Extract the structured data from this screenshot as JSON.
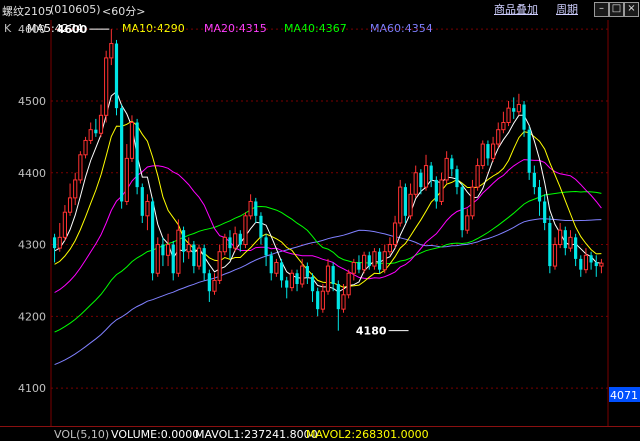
{
  "header": {
    "symbol": "螺纹2105",
    "code": "(010605)",
    "period": "<60分>",
    "k_label": "K",
    "ma5": "MA5:4274",
    "ma10": "MA10:4290",
    "ma20": "MA20:4315",
    "ma40": "MA40:4367",
    "ma60": "MA60:4354",
    "btn_overlay": "商品叠加",
    "btn_cycle": "周期"
  },
  "footer": {
    "vol": "VOL(5,10)",
    "volume": "VOLUME:0.0000",
    "mavol1": "MAVOL1:237241.8000",
    "mavol2": "MAVOL2:268301.0000"
  },
  "colors": {
    "up": "#ff3232",
    "down": "#00e6e6",
    "ma5": "#ffffff",
    "ma10": "#ffff00",
    "ma20": "#ff00ff",
    "ma40": "#00ff00",
    "ma60": "#8080ff",
    "grid": "#7a0000",
    "axis_text": "#c0c0c0",
    "price_box": "#0050ff"
  },
  "chart_data": {
    "type": "candlestick",
    "ylim": [
      4050,
      4610
    ],
    "y_ticks": [
      4600,
      4500,
      4400,
      4300,
      4200,
      4100
    ],
    "current_price": "4071",
    "annotations": [
      {
        "label": "4600",
        "index": 11,
        "value": 4600
      },
      {
        "label": "4180",
        "index": 69,
        "value": 4180
      }
    ],
    "candles": [
      [
        4310,
        4295,
        4315,
        4275
      ],
      [
        4295,
        4310,
        4330,
        4290
      ],
      [
        4310,
        4345,
        4355,
        4305
      ],
      [
        4345,
        4365,
        4385,
        4340
      ],
      [
        4365,
        4390,
        4400,
        4355
      ],
      [
        4390,
        4425,
        4430,
        4385
      ],
      [
        4425,
        4445,
        4450,
        4420
      ],
      [
        4445,
        4460,
        4470,
        4440
      ],
      [
        4460,
        4455,
        4475,
        4450
      ],
      [
        4455,
        4480,
        4495,
        4450
      ],
      [
        4480,
        4560,
        4570,
        4470
      ],
      [
        4560,
        4580,
        4600,
        4550
      ],
      [
        4580,
        4490,
        4585,
        4480
      ],
      [
        4490,
        4360,
        4495,
        4350
      ],
      [
        4360,
        4420,
        4440,
        4355
      ],
      [
        4420,
        4470,
        4480,
        4415
      ],
      [
        4470,
        4380,
        4475,
        4370
      ],
      [
        4380,
        4340,
        4385,
        4330
      ],
      [
        4340,
        4360,
        4370,
        4320
      ],
      [
        4360,
        4260,
        4365,
        4250
      ],
      [
        4260,
        4300,
        4310,
        4255
      ],
      [
        4300,
        4285,
        4310,
        4270
      ],
      [
        4285,
        4300,
        4315,
        4270
      ],
      [
        4300,
        4260,
        4305,
        4250
      ],
      [
        4260,
        4320,
        4335,
        4255
      ],
      [
        4320,
        4290,
        4325,
        4275
      ],
      [
        4290,
        4300,
        4310,
        4280
      ],
      [
        4300,
        4270,
        4305,
        4260
      ],
      [
        4270,
        4295,
        4300,
        4265
      ],
      [
        4295,
        4260,
        4300,
        4250
      ],
      [
        4260,
        4235,
        4265,
        4220
      ],
      [
        4235,
        4250,
        4260,
        4230
      ],
      [
        4250,
        4290,
        4300,
        4245
      ],
      [
        4290,
        4310,
        4315,
        4285
      ],
      [
        4310,
        4295,
        4320,
        4280
      ],
      [
        4295,
        4315,
        4325,
        4290
      ],
      [
        4315,
        4300,
        4320,
        4290
      ],
      [
        4300,
        4340,
        4345,
        4295
      ],
      [
        4340,
        4360,
        4370,
        4335
      ],
      [
        4360,
        4340,
        4365,
        4330
      ],
      [
        4340,
        4310,
        4345,
        4300
      ],
      [
        4310,
        4285,
        4315,
        4270
      ],
      [
        4285,
        4260,
        4290,
        4250
      ],
      [
        4260,
        4275,
        4280,
        4255
      ],
      [
        4275,
        4250,
        4280,
        4240
      ],
      [
        4250,
        4240,
        4255,
        4225
      ],
      [
        4240,
        4260,
        4265,
        4235
      ],
      [
        4260,
        4245,
        4265,
        4235
      ],
      [
        4245,
        4270,
        4280,
        4240
      ],
      [
        4270,
        4255,
        4275,
        4245
      ],
      [
        4255,
        4235,
        4260,
        4220
      ],
      [
        4235,
        4210,
        4240,
        4200
      ],
      [
        4210,
        4235,
        4245,
        4205
      ],
      [
        4235,
        4270,
        4280,
        4230
      ],
      [
        4270,
        4245,
        4275,
        4235
      ],
      [
        4245,
        4210,
        4250,
        4180
      ],
      [
        4210,
        4230,
        4245,
        4205
      ],
      [
        4230,
        4260,
        4265,
        4225
      ],
      [
        4260,
        4275,
        4280,
        4250
      ],
      [
        4275,
        4265,
        4285,
        4260
      ],
      [
        4265,
        4285,
        4290,
        4260
      ],
      [
        4285,
        4270,
        4290,
        4265
      ],
      [
        4270,
        4290,
        4295,
        4265
      ],
      [
        4290,
        4265,
        4295,
        4260
      ],
      [
        4265,
        4290,
        4300,
        4260
      ],
      [
        4290,
        4300,
        4310,
        4285
      ],
      [
        4300,
        4330,
        4340,
        4295
      ],
      [
        4330,
        4380,
        4390,
        4325
      ],
      [
        4380,
        4340,
        4385,
        4330
      ],
      [
        4340,
        4370,
        4385,
        4335
      ],
      [
        4370,
        4400,
        4410,
        4365
      ],
      [
        4400,
        4380,
        4405,
        4370
      ],
      [
        4380,
        4410,
        4425,
        4375
      ],
      [
        4410,
        4390,
        4415,
        4380
      ],
      [
        4390,
        4360,
        4395,
        4350
      ],
      [
        4360,
        4390,
        4400,
        4355
      ],
      [
        4390,
        4420,
        4430,
        4385
      ],
      [
        4420,
        4405,
        4425,
        4395
      ],
      [
        4405,
        4380,
        4410,
        4370
      ],
      [
        4380,
        4320,
        4385,
        4310
      ],
      [
        4320,
        4340,
        4350,
        4315
      ],
      [
        4340,
        4380,
        4390,
        4335
      ],
      [
        4380,
        4410,
        4420,
        4375
      ],
      [
        4410,
        4440,
        4445,
        4405
      ],
      [
        4440,
        4420,
        4445,
        4410
      ],
      [
        4420,
        4440,
        4450,
        4415
      ],
      [
        4440,
        4460,
        4470,
        4435
      ],
      [
        4460,
        4470,
        4485,
        4455
      ],
      [
        4470,
        4490,
        4500,
        4465
      ],
      [
        4490,
        4485,
        4505,
        4475
      ],
      [
        4485,
        4495,
        4510,
        4480
      ],
      [
        4495,
        4460,
        4500,
        4450
      ],
      [
        4460,
        4400,
        4465,
        4390
      ],
      [
        4400,
        4380,
        4410,
        4370
      ],
      [
        4380,
        4360,
        4390,
        4340
      ],
      [
        4360,
        4330,
        4370,
        4320
      ],
      [
        4330,
        4270,
        4340,
        4260
      ],
      [
        4270,
        4300,
        4310,
        4265
      ],
      [
        4300,
        4320,
        4330,
        4295
      ],
      [
        4320,
        4295,
        4325,
        4285
      ],
      [
        4295,
        4310,
        4320,
        4290
      ],
      [
        4310,
        4280,
        4315,
        4270
      ],
      [
        4280,
        4265,
        4285,
        4255
      ],
      [
        4265,
        4285,
        4295,
        4260
      ],
      [
        4285,
        4275,
        4290,
        4265
      ],
      [
        4275,
        4270,
        4285,
        4255
      ],
      [
        4270,
        4274,
        4280,
        4260
      ]
    ]
  }
}
